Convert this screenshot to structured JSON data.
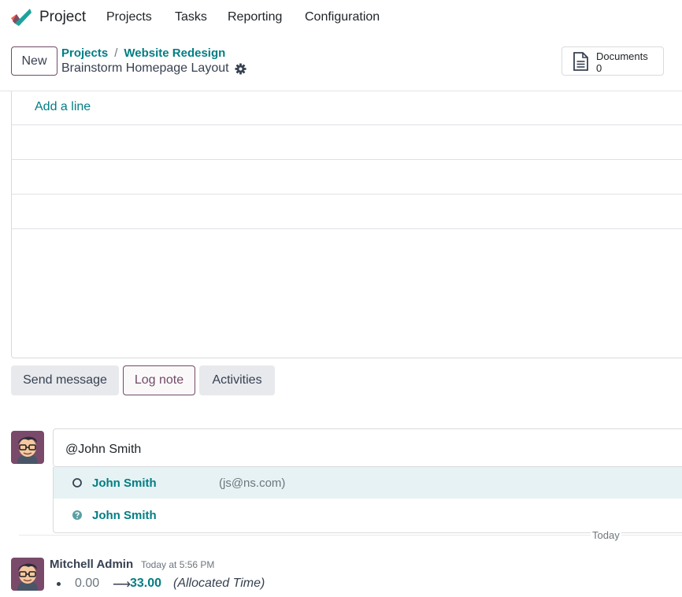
{
  "nav": {
    "app_name": "Project",
    "menu": [
      "Projects",
      "Tasks",
      "Reporting",
      "Configuration"
    ]
  },
  "control_panel": {
    "new_label": "New",
    "breadcrumb": [
      "Projects",
      "Website Redesign"
    ],
    "breadcrumb_sep": "/",
    "record_title": "Brainstorm Homepage Layout",
    "documents_label": "Documents",
    "documents_count": "0"
  },
  "sheet": {
    "add_line_label": "Add a line"
  },
  "chatter": {
    "send_message_label": "Send message",
    "log_note_label": "Log note",
    "activities_label": "Activities",
    "composer_value": "@John Smith",
    "suggestions": [
      {
        "name": "John Smith",
        "email": "(js@ns.com)",
        "icon": "circle-outline-icon"
      },
      {
        "name": "John Smith",
        "email": "",
        "icon": "question-circle-icon"
      }
    ],
    "date_separator": "Today",
    "message": {
      "author": "Mitchell Admin",
      "date": "Today at 5:56 PM",
      "old_value": "0.00",
      "arrow": "⟶",
      "new_value": "33.00",
      "field": "(Allocated Time)"
    }
  },
  "colors": {
    "brand_purple": "#714b67",
    "link_teal": "#017e84"
  }
}
